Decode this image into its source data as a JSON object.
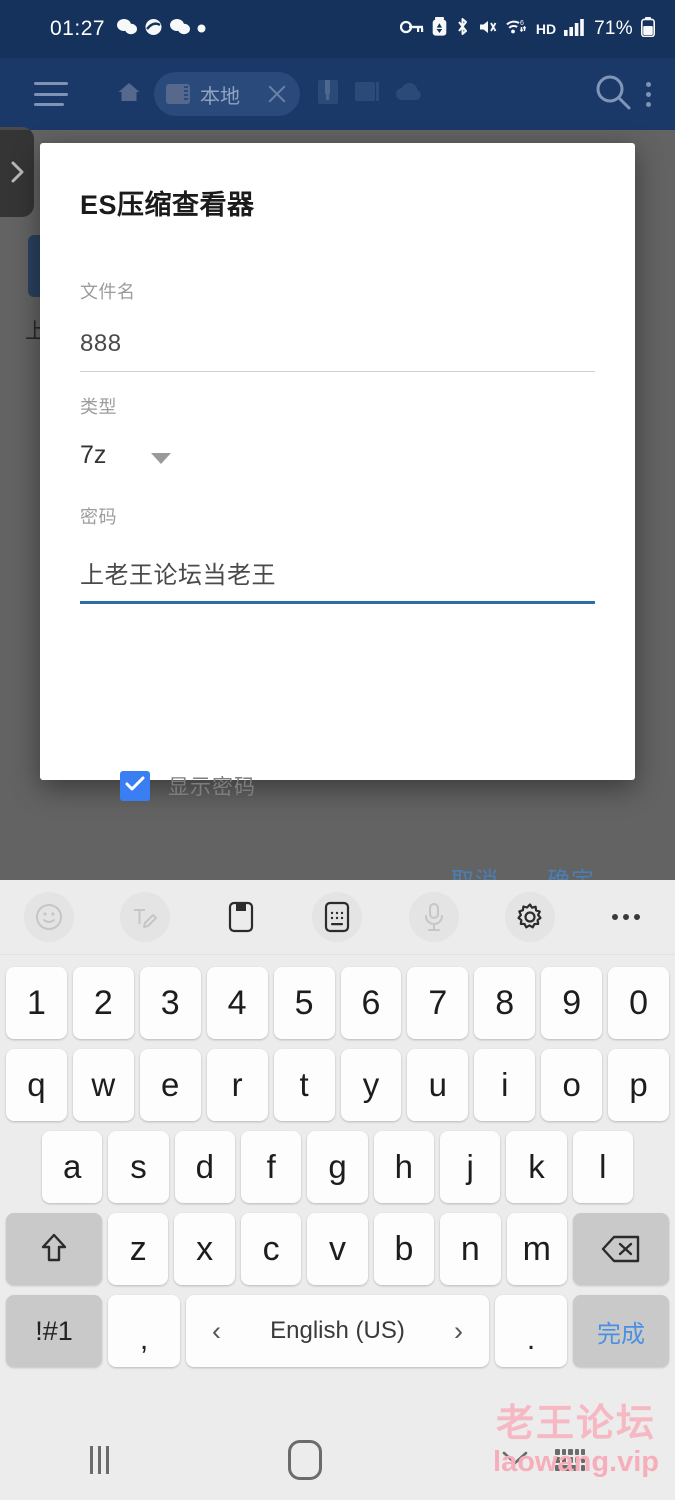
{
  "status_bar": {
    "time": "01:27",
    "left_icons": [
      "wechat-icon",
      "browser-icon",
      "wechat-icon",
      "dot-icon"
    ],
    "right_icons": [
      "key-icon",
      "battery-saver-icon",
      "bluetooth-icon",
      "mute-icon",
      "wifi-icon",
      "hd-icon",
      "signal-icon"
    ],
    "battery": "71%"
  },
  "app_bar": {
    "menu_icon": "hamburger-icon",
    "home_icon": "home-icon",
    "tab": {
      "label": "本地",
      "close_icon": "close-icon",
      "thumb_icon": "sdcard-icon"
    },
    "extra_icons": [
      "archive-icon",
      "library-icon",
      "cloud-icon"
    ],
    "search_icon": "search-icon",
    "overflow_icon": "more-vertical-icon"
  },
  "background": {
    "file_caption": "上...",
    "edge_handle_icon": "chevron-right-icon"
  },
  "dialog": {
    "title": "ES压缩查看器",
    "filename": {
      "label": "文件名",
      "value": "888"
    },
    "type": {
      "label": "类型",
      "value": "7z",
      "caret_icon": "caret-down-icon"
    },
    "password": {
      "label": "密码",
      "value": "上老王论坛当老王"
    },
    "show_password": {
      "label": "显示密码",
      "checked": true,
      "check_icon": "check-icon"
    },
    "cancel_label": "取消",
    "confirm_label": "确定",
    "accent_color": "#4a7fb5",
    "active_underline_color": "#2e6ea8",
    "checkbox_color": "#3a7ef4"
  },
  "keyboard": {
    "toolbar": [
      "emoji-icon",
      "handwriting-icon",
      "clipboard-icon",
      "keyboard-mode-icon",
      "microphone-icon",
      "settings-gear-icon",
      "more-horizontal-icon"
    ],
    "row_numbers": [
      "1",
      "2",
      "3",
      "4",
      "5",
      "6",
      "7",
      "8",
      "9",
      "0"
    ],
    "row_top": [
      "q",
      "w",
      "e",
      "r",
      "t",
      "y",
      "u",
      "i",
      "o",
      "p"
    ],
    "row_home": [
      "a",
      "s",
      "d",
      "f",
      "g",
      "h",
      "j",
      "k",
      "l"
    ],
    "row_bottom": [
      "z",
      "x",
      "c",
      "v",
      "b",
      "n",
      "m"
    ],
    "shift_icon": "shift-icon",
    "backspace_icon": "backspace-icon",
    "symbols_label": "!#1",
    "comma_label": ",",
    "space_label": "English (US)",
    "space_prev_icon": "chevron-left-icon",
    "space_next_icon": "chevron-right-icon",
    "period_label": ".",
    "done_label": "完成",
    "done_color": "#4a90e2"
  },
  "nav_bar": {
    "recents_icon": "recents-icon",
    "home_icon": "home-circle-icon",
    "hide_keyboard_icon": "chevron-down-icon",
    "keyboard_icon": "keyboard-icon"
  },
  "watermark": {
    "line1": "老王论坛",
    "line2": "laowang.vip",
    "color": "#f4b0bd"
  }
}
